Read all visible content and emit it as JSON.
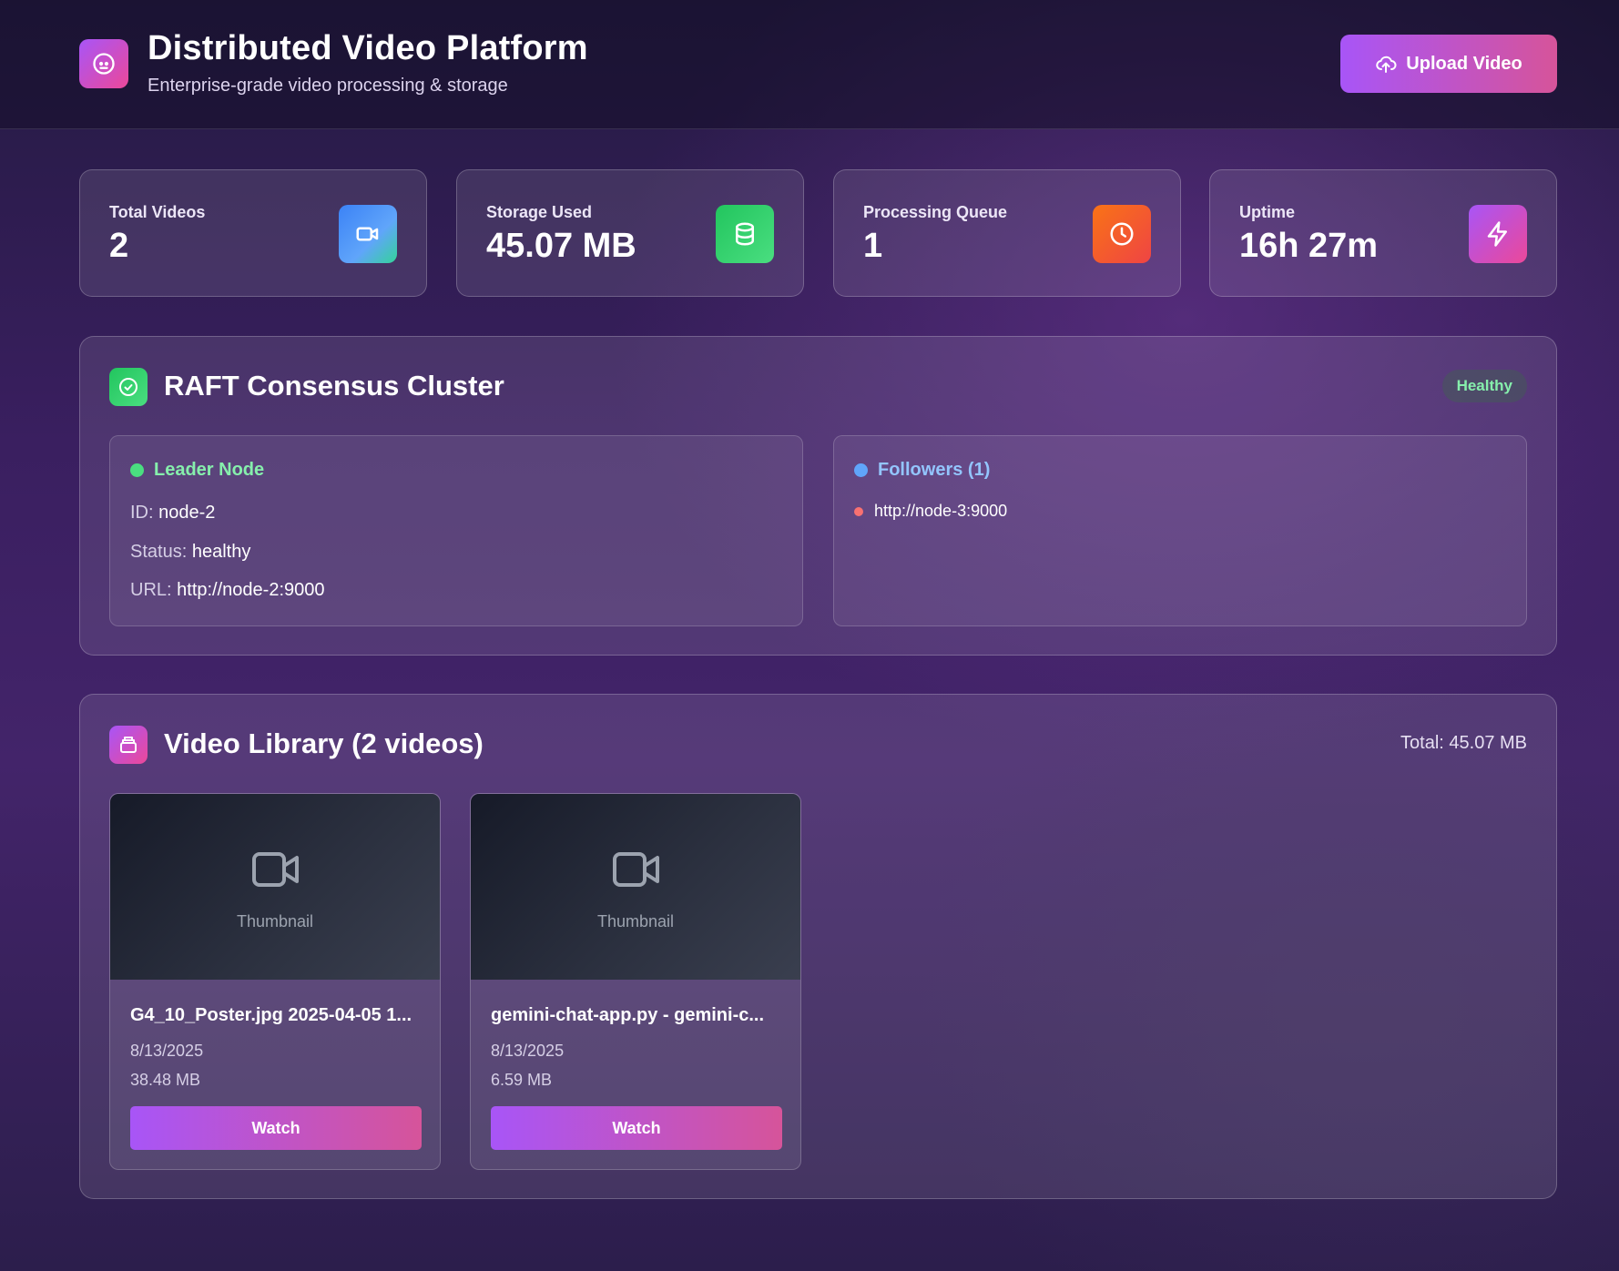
{
  "header": {
    "title": "Distributed Video Platform",
    "subtitle": "Enterprise-grade video processing & storage",
    "upload_label": "Upload Video"
  },
  "stats": [
    {
      "label": "Total Videos",
      "value": "2",
      "icon": "video-icon",
      "color": "#3b82f6"
    },
    {
      "label": "Storage Used",
      "value": "45.07 MB",
      "icon": "database-icon",
      "color": "#22c55e"
    },
    {
      "label": "Processing Queue",
      "value": "1",
      "icon": "clock-icon",
      "color": "#f97316"
    },
    {
      "label": "Uptime",
      "value": "16h 27m",
      "icon": "lightning-icon",
      "color": "#a855f7"
    }
  ],
  "cluster": {
    "title": "RAFT Consensus Cluster",
    "status_badge": "Healthy",
    "leader": {
      "heading": "Leader Node",
      "id_label": "ID:",
      "id_value": "node-2",
      "status_label": "Status:",
      "status_value": "healthy",
      "url_label": "URL:",
      "url_value": "http://node-2:9000"
    },
    "followers": {
      "heading": "Followers (1)",
      "items": [
        "http://node-3:9000"
      ]
    }
  },
  "library": {
    "title": "Video Library (2 videos)",
    "total": "Total: 45.07 MB",
    "videos": [
      {
        "thumbnail_label": "Thumbnail",
        "title": "G4_10_Poster.jpg 2025-04-05 1...",
        "date": "8/13/2025",
        "size": "38.48 MB",
        "action": "Watch"
      },
      {
        "thumbnail_label": "Thumbnail",
        "title": "gemini-chat-app.py - gemini-c...",
        "date": "8/13/2025",
        "size": "6.59 MB",
        "action": "Watch"
      }
    ]
  },
  "colors": {
    "accent_start": "#a855f7",
    "accent_end": "#ec4899",
    "leader_green": "#86efac",
    "follower_blue": "#93c5fd",
    "follower_dot": "#f87171"
  }
}
